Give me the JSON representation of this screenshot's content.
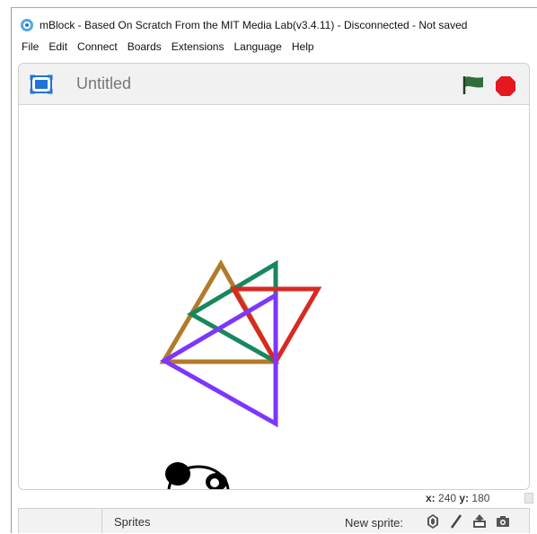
{
  "window": {
    "title": "mBlock - Based On Scratch From the MIT Media Lab(v3.4.11) - Disconnected - Not saved"
  },
  "menu": {
    "items": [
      "File",
      "Edit",
      "Connect",
      "Boards",
      "Extensions",
      "Language",
      "Help"
    ]
  },
  "stage": {
    "project_title": "Untitled",
    "coords": {
      "x_label": "x:",
      "x_value": "240",
      "y_label": "y:",
      "y_value": "180"
    }
  },
  "sprites_panel": {
    "sprites_label": "Sprites",
    "new_sprite_label": "New sprite:"
  },
  "colors": {
    "green_flag": "#2f6f3a",
    "stop": "#e5171f",
    "triangle_brown": "#b27a2b",
    "triangle_green": "#17875d",
    "triangle_red": "#d62a22",
    "triangle_purple": "#7d36ff"
  },
  "icons": {
    "app": "mblock-icon",
    "presentation": "presentation-mode-icon",
    "flag": "green-flag-icon",
    "stop": "stop-icon",
    "paint_new": "paint-new-sprite-icon",
    "upload": "upload-sprite-icon",
    "camera": "camera-sprite-icon",
    "choose_library": "choose-sprite-from-library-icon"
  }
}
